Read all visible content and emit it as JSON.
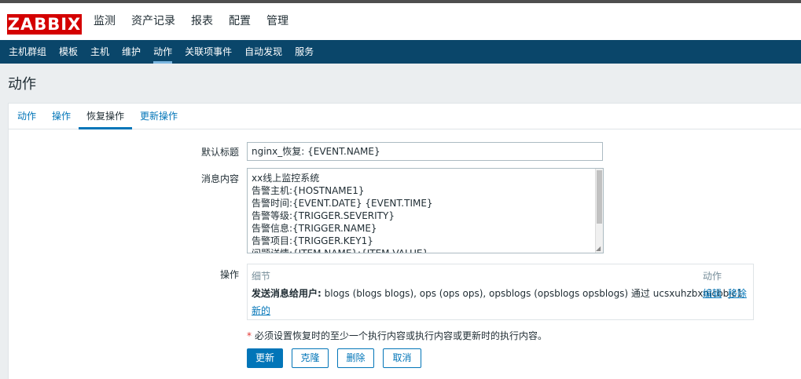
{
  "logo": "ZABBIX",
  "main_nav": [
    {
      "label": "监测"
    },
    {
      "label": "资产记录"
    },
    {
      "label": "报表"
    },
    {
      "label": "配置"
    },
    {
      "label": "管理"
    }
  ],
  "sub_nav": [
    {
      "label": "主机群组"
    },
    {
      "label": "模板"
    },
    {
      "label": "主机"
    },
    {
      "label": "维护"
    },
    {
      "label": "动作",
      "selected": true
    },
    {
      "label": "关联项事件"
    },
    {
      "label": "自动发现"
    },
    {
      "label": "服务"
    }
  ],
  "page_title": "动作",
  "tabs": [
    {
      "label": "动作"
    },
    {
      "label": "操作"
    },
    {
      "label": "恢复操作",
      "active": true
    },
    {
      "label": "更新操作"
    }
  ],
  "form": {
    "subject_label": "默认标题",
    "subject_value": "nginx_恢复: {EVENT.NAME}",
    "message_label": "消息内容",
    "message_lines": [
      "xx线上监控系统",
      "告警主机:{HOSTNAME1}",
      "告警时间:{EVENT.DATE} {EVENT.TIME}",
      "告警等级:{TRIGGER.SEVERITY}",
      "告警信息:{TRIGGER.NAME}",
      "告警项目:{TRIGGER.KEY1}",
      "问题详情:{ITEM.NAME}:{ITEM.VALUE}"
    ],
    "operations_label": "操作",
    "operations": {
      "col_details": "细节",
      "col_action": "动作",
      "row_bold": "发送消息给用户:",
      "row_text": "blogs (blogs blogs), ops (ops ops), opsblogs (opsblogs opsblogs) 通过 ucsxuhzbxnicbbjc1",
      "edit_link": "编辑",
      "remove_link": "移除",
      "new_link": "新的"
    },
    "required_note": "必须设置恢复时的至少一个执行内容或执行内容或更新时的执行内容。"
  },
  "buttons": {
    "update": "更新",
    "clone": "克隆",
    "delete": "删除",
    "cancel": "取消"
  },
  "colors": {
    "brand": "#d40000",
    "subnav_bg": "#0a466a",
    "accent": "#0275b8"
  }
}
